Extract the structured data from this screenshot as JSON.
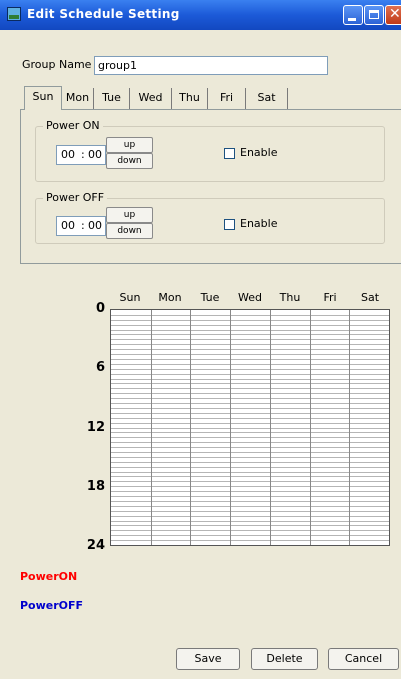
{
  "window": {
    "title": "Edit Schedule Setting"
  },
  "group_name": {
    "label": "Group Name",
    "value": "group1"
  },
  "tabs": [
    "Sun",
    "Mon",
    "Tue",
    "Wed",
    "Thu",
    "Fri",
    "Sat"
  ],
  "selected_tab": "Sun",
  "power_on": {
    "title": "Power ON",
    "hour": "00",
    "sep": ":",
    "minute": "00",
    "up": "up",
    "down": "down",
    "enable_label": "Enable",
    "enabled": false
  },
  "power_off": {
    "title": "Power OFF",
    "hour": "00",
    "sep": ":",
    "minute": "00",
    "up": "up",
    "down": "down",
    "enable_label": "Enable",
    "enabled": false
  },
  "schedule": {
    "days": [
      "Sun",
      "Mon",
      "Tue",
      "Wed",
      "Thu",
      "Fri",
      "Sat"
    ],
    "hour_ticks": [
      "0",
      "6",
      "12",
      "18",
      "24"
    ]
  },
  "legend": {
    "power_on": "PowerON",
    "power_off": "PowerOFF",
    "power_on_color": "#ff0000",
    "power_off_color": "#0000cc"
  },
  "buttons": {
    "save": "Save",
    "delete": "Delete",
    "cancel": "Cancel"
  }
}
